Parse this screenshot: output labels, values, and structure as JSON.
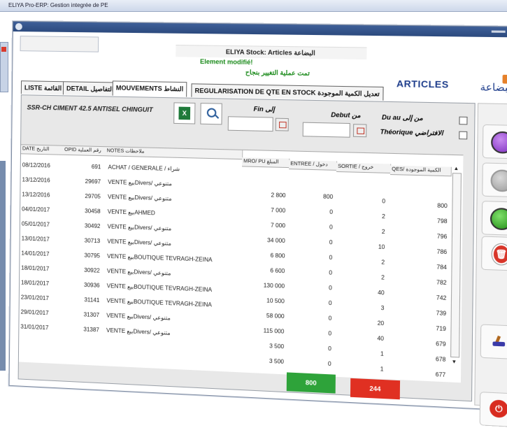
{
  "outer_title": "ELIYA Pro-ERP: Gestion integrée de PE",
  "window": {
    "title": "ELIYA Stock: Articles البضاعة",
    "status_modified": "Element modifié!",
    "status_modified_ar": "تمت عملية التغيير بنجاح",
    "section_title": "ARTICLES",
    "section_title_ar": "البضاعة"
  },
  "tabs": [
    {
      "label": "LISTE القائمة"
    },
    {
      "label": "DETAIL التفاصيل"
    },
    {
      "label": "MOUVEMENTS النشاط"
    },
    {
      "label": "REGULARISATION DE QTE EN STOCK تعديل الكمية الموجودة"
    }
  ],
  "filters": {
    "article_name": "SSR-CH CIMENT 42.5 ANTISEL CHINGUIT",
    "excel_label": "X",
    "fin_label": "Fin إلى",
    "debut_label": "Debut من",
    "du_au_label": "Du au من إلى",
    "theorique_label": "Théorique الافتراضي"
  },
  "columns": {
    "date": "DATE التاريخ",
    "opid": "OPID رقم العملية",
    "notes": "NOTES ملاحظات",
    "mro_pu": "MRO/ PU المبلغ",
    "entree": "ENTREE / دخول",
    "sortie": "SORTIE / خروج",
    "qes": "QES/ الكمية الموجودة"
  },
  "rows": [
    {
      "date": "08/12/2016",
      "opid": "691",
      "notes": "ACHAT / GENERALE / شراء",
      "pu": "",
      "entree": "",
      "sortie": "",
      "qes": ""
    },
    {
      "date": "13/12/2016",
      "opid": "29697",
      "notes": "VENTE بيعDivers/ متنوعي",
      "pu": "2 800",
      "entree": "800",
      "sortie": "0",
      "qes": "800"
    },
    {
      "date": "13/12/2016",
      "opid": "29705",
      "notes": "VENTE بيعDivers/ متنوعي",
      "pu": "7 000",
      "entree": "0",
      "sortie": "2",
      "qes": "798"
    },
    {
      "date": "04/01/2017",
      "opid": "30458",
      "notes": "VENTE بيعAHMED",
      "pu": "7 000",
      "entree": "0",
      "sortie": "2",
      "qes": "796"
    },
    {
      "date": "05/01/2017",
      "opid": "30492",
      "notes": "VENTE بيعDivers/ متنوعي",
      "pu": "34 000",
      "entree": "0",
      "sortie": "10",
      "qes": "786"
    },
    {
      "date": "13/01/2017",
      "opid": "30713",
      "notes": "VENTE بيعDivers/ متنوعي",
      "pu": "6 800",
      "entree": "0",
      "sortie": "2",
      "qes": "784"
    },
    {
      "date": "14/01/2017",
      "opid": "30795",
      "notes": "VENTE بيعBOUTIQUE TEVRAGH-ZEINA",
      "pu": "6 600",
      "entree": "0",
      "sortie": "2",
      "qes": "782"
    },
    {
      "date": "18/01/2017",
      "opid": "30922",
      "notes": "VENTE بيعDivers/ متنوعي",
      "pu": "130 000",
      "entree": "0",
      "sortie": "40",
      "qes": "742"
    },
    {
      "date": "18/01/2017",
      "opid": "30936",
      "notes": "VENTE بيعBOUTIQUE TEVRAGH-ZEINA",
      "pu": "10 500",
      "entree": "0",
      "sortie": "3",
      "qes": "739"
    },
    {
      "date": "23/01/2017",
      "opid": "31141",
      "notes": "VENTE بيعBOUTIQUE TEVRAGH-ZEINA",
      "pu": "58 000",
      "entree": "0",
      "sortie": "20",
      "qes": "719"
    },
    {
      "date": "29/01/2017",
      "opid": "31307",
      "notes": "VENTE بيعDivers/ متنوعي",
      "pu": "115 000",
      "entree": "0",
      "sortie": "40",
      "qes": "679"
    },
    {
      "date": "31/01/2017",
      "opid": "31387",
      "notes": "VENTE بيعDivers/ متنوعي",
      "pu": "3 500",
      "entree": "0",
      "sortie": "1",
      "qes": "678"
    },
    {
      "date": "",
      "opid": "",
      "notes": "",
      "pu": "3 500",
      "entree": "0",
      "sortie": "1",
      "qes": "677"
    }
  ],
  "totals": {
    "entree": "800",
    "sortie": "244"
  },
  "colors": {
    "accent": "#1f3e8c",
    "positive": "#2ea33a",
    "negative": "#e03022",
    "modified": "#1a8a1a"
  },
  "icons": [
    "excel-icon",
    "search-icon",
    "calendar-icon",
    "purple-circle-icon",
    "grey-circle-icon",
    "green-circle-icon",
    "trash-icon",
    "brush-icon",
    "power-icon"
  ]
}
